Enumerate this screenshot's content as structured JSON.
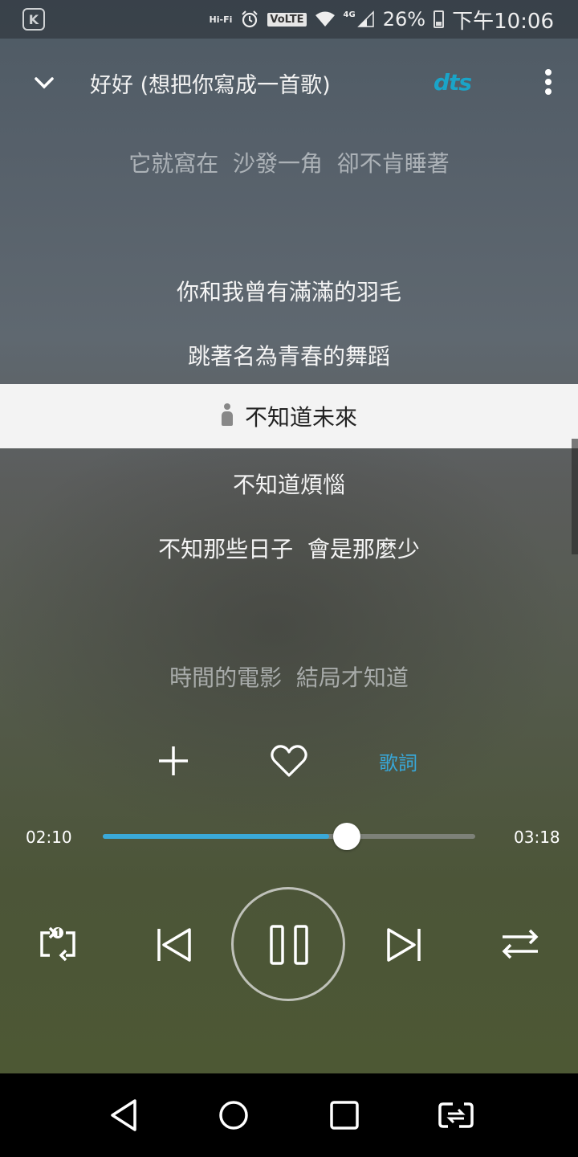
{
  "status_bar": {
    "app_icon_letter": "K",
    "hifi_label": "Hi-Fi",
    "volte_label": "VoLTE",
    "network_label": "4G",
    "battery": "26%",
    "time": "下午10:06"
  },
  "header": {
    "title": "好好 (想把你寫成一首歌)",
    "brand": "dts"
  },
  "lyrics": {
    "line_prev_far": "它就窩在  沙發一角  卻不肯睡著",
    "line_prev_2": "你和我曾有滿滿的羽毛",
    "line_prev_1": "跳著名為青春的舞蹈",
    "line_current": "不知道未來",
    "line_next_1": "不知道煩惱",
    "line_next_2": "不知那些日子  會是那麼少",
    "line_next_far": "時間的電影  結局才知道"
  },
  "actions": {
    "lyrics_label": "歌詞"
  },
  "progress": {
    "elapsed": "02:10",
    "total": "03:18",
    "fraction": 0.656
  },
  "colors": {
    "accent": "#3aa9d9",
    "dts_brand": "#1aa4c8"
  },
  "icons": {
    "repeat_one": "repeat-one-icon",
    "previous": "skip-previous-icon",
    "pause": "pause-icon",
    "next": "skip-next-icon",
    "shuffle": "shuffle-icon"
  }
}
